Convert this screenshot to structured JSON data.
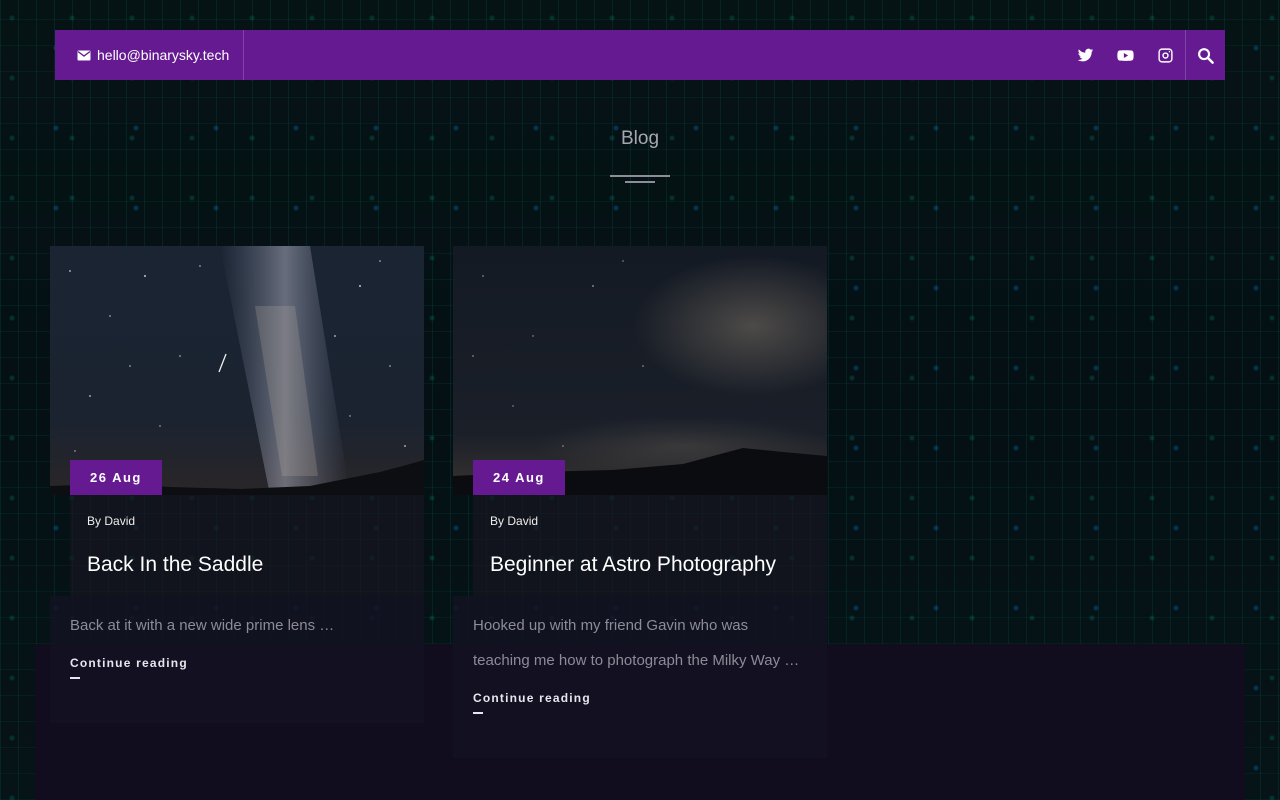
{
  "header": {
    "email": "hello@binarysky.tech",
    "social_icons": [
      "twitter-icon",
      "youtube-icon",
      "instagram-icon"
    ],
    "search_icon": "search-icon",
    "bar_color": "#661a92"
  },
  "page": {
    "title": "Blog"
  },
  "posts": [
    {
      "date": "26 Aug",
      "by_label": "By",
      "author": "David",
      "title": "Back In the Saddle",
      "excerpt": "Back at it with a new wide prime lens …",
      "continue_label": "Continue reading"
    },
    {
      "date": "24 Aug",
      "by_label": "By",
      "author": "David",
      "title": "Beginner at Astro Photography",
      "excerpt": "Hooked up with my friend Gavin who was teaching me how to photograph the Milky Way …",
      "continue_label": "Continue reading"
    }
  ]
}
